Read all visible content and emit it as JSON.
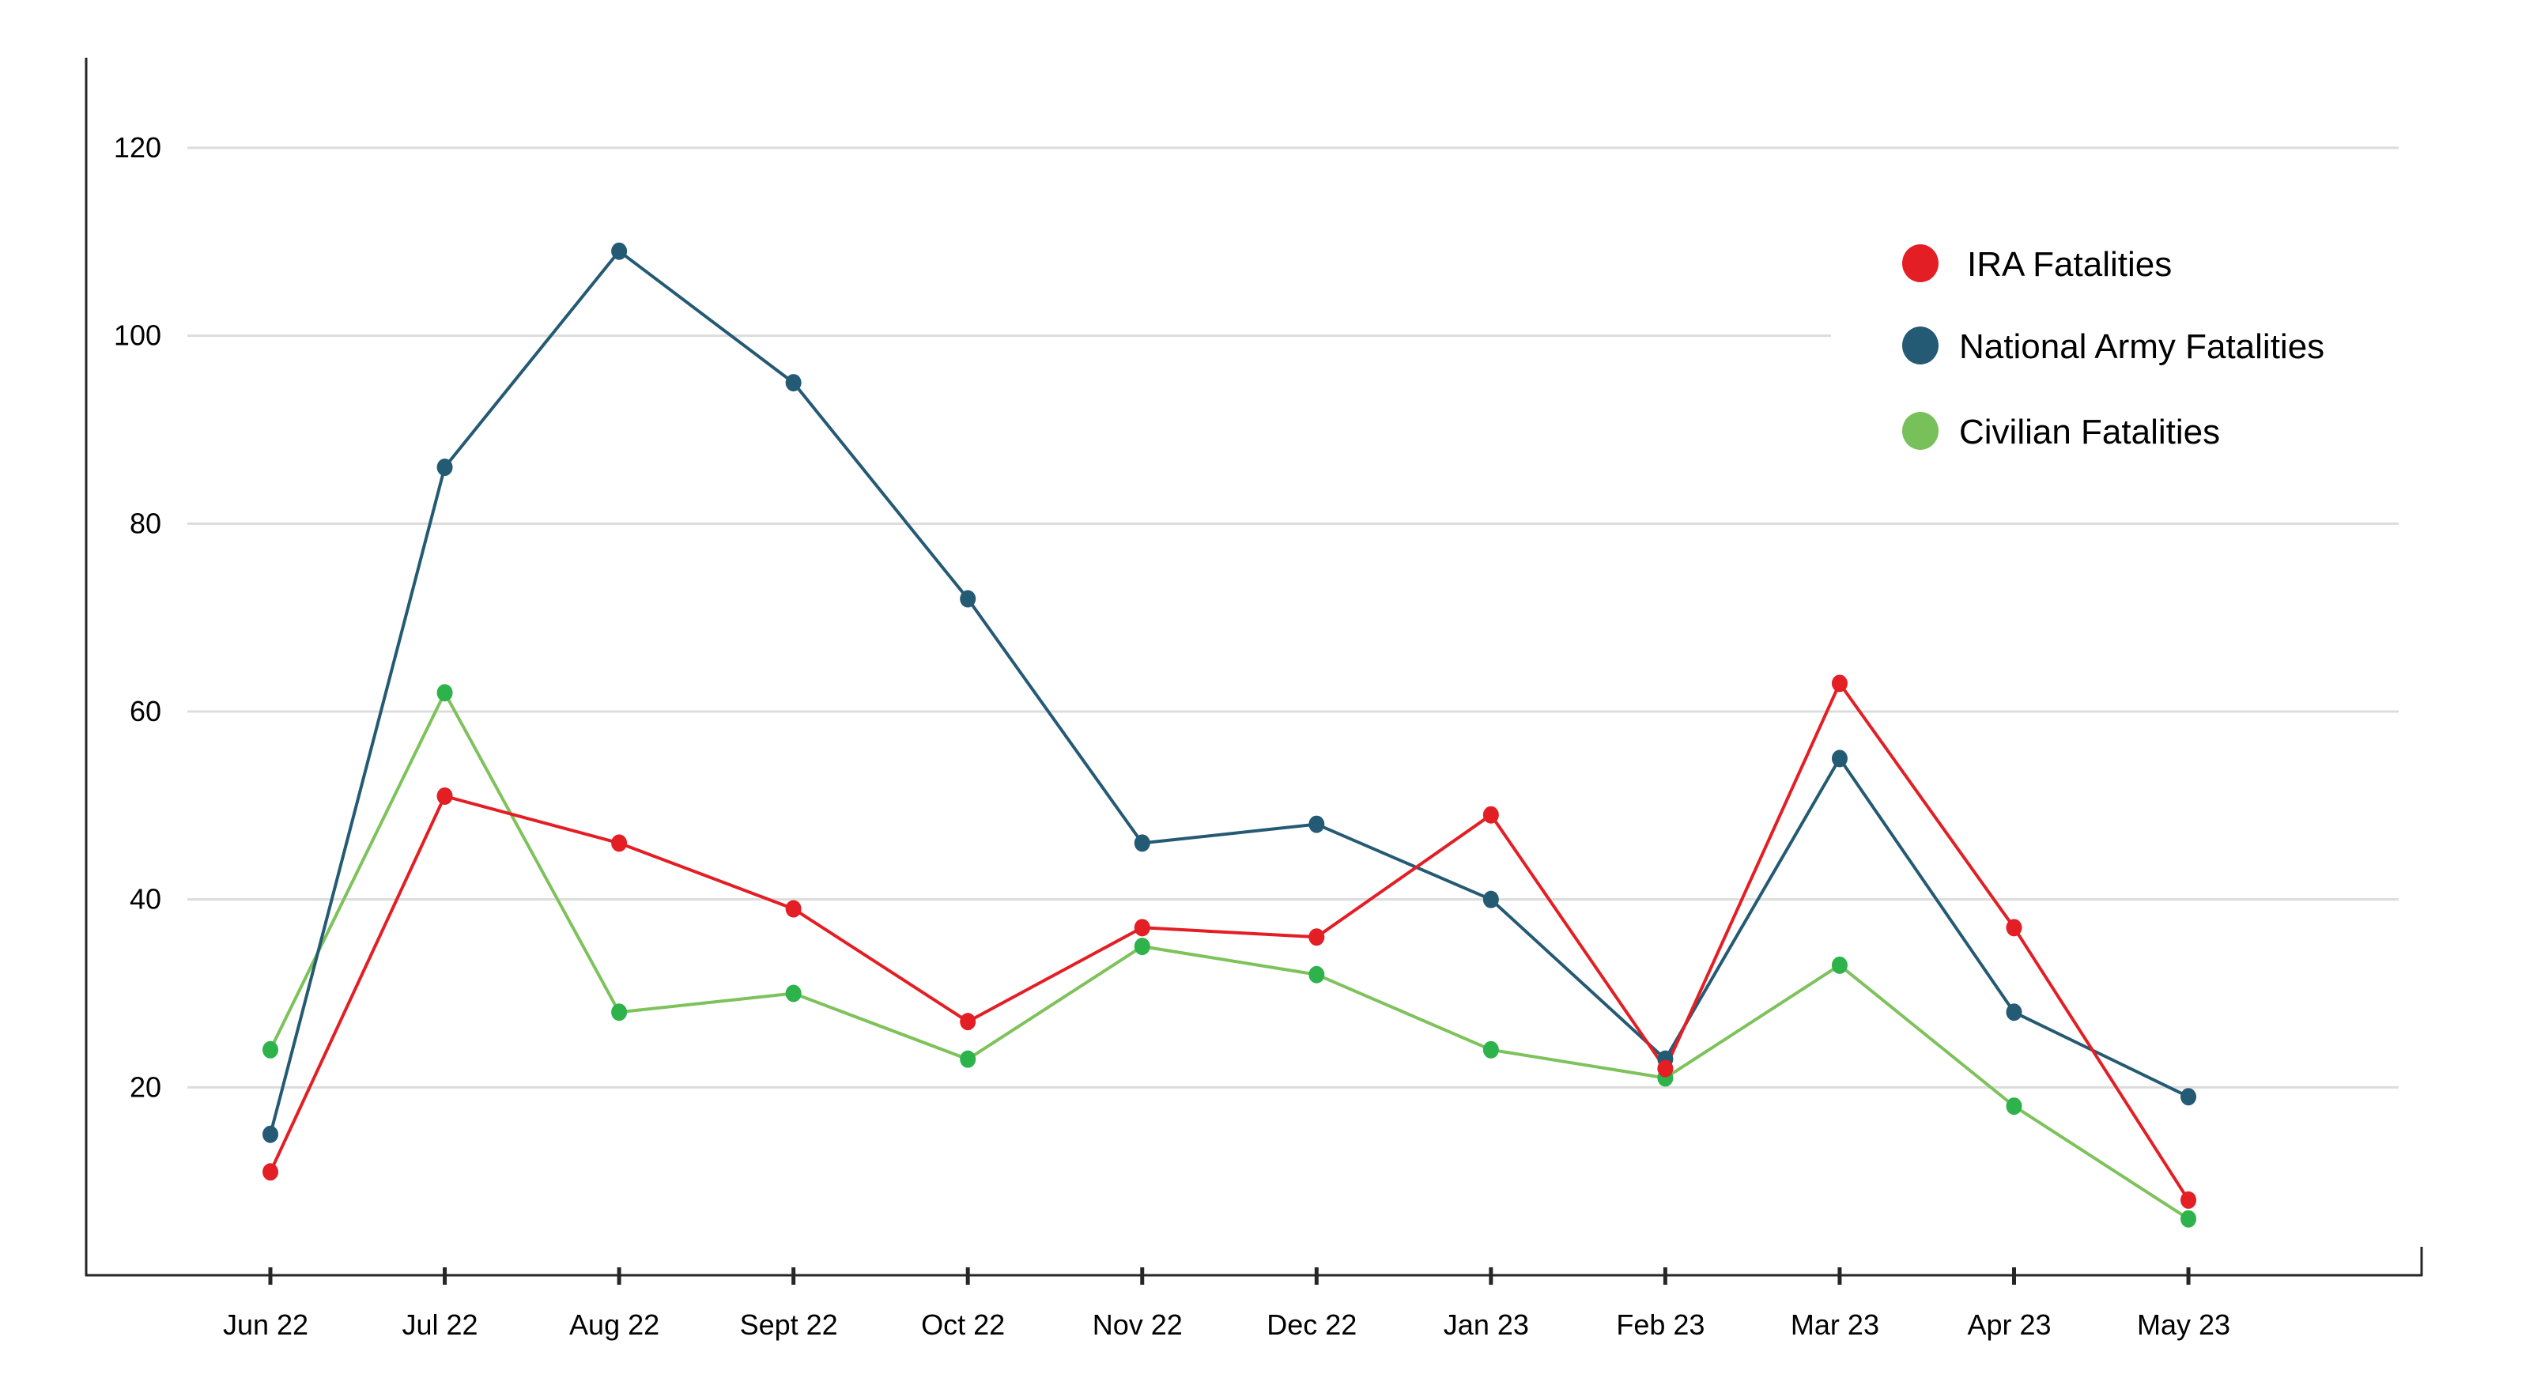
{
  "chart_data": {
    "type": "line",
    "title": "",
    "xlabel": "",
    "ylabel": "",
    "ylim": [
      0,
      120
    ],
    "yticks": [
      20,
      40,
      60,
      80,
      100,
      120
    ],
    "grid": true,
    "legend_position": "top-right",
    "categories": [
      "Jun 22",
      "Jul 22",
      "Aug 22",
      "Sept 22",
      "Oct 22",
      "Nov 22",
      "Dec 22",
      "Jan 23",
      "Feb 23",
      "Mar 23",
      "Apr 23",
      "May 23"
    ],
    "series": [
      {
        "name": "IRA Fatalities",
        "line_color": "#E31E24",
        "marker_color": "#E31E24",
        "legend_color": "#E31E24",
        "values": [
          11,
          51,
          46,
          39,
          27,
          37,
          36,
          49,
          22,
          63,
          37,
          8
        ]
      },
      {
        "name": "National Army Fatalities",
        "line_color": "#245A73",
        "marker_color": "#245A73",
        "legend_color": "#245A73",
        "values": [
          15,
          86,
          109,
          95,
          72,
          46,
          48,
          40,
          23,
          55,
          28,
          19
        ]
      },
      {
        "name": "Civilian Fatalities",
        "line_color": "#7DC25B",
        "marker_color": "#2EB24B",
        "legend_color": "#77C05A",
        "values": [
          24,
          62,
          28,
          30,
          23,
          35,
          32,
          24,
          21,
          33,
          18,
          6
        ]
      }
    ]
  }
}
